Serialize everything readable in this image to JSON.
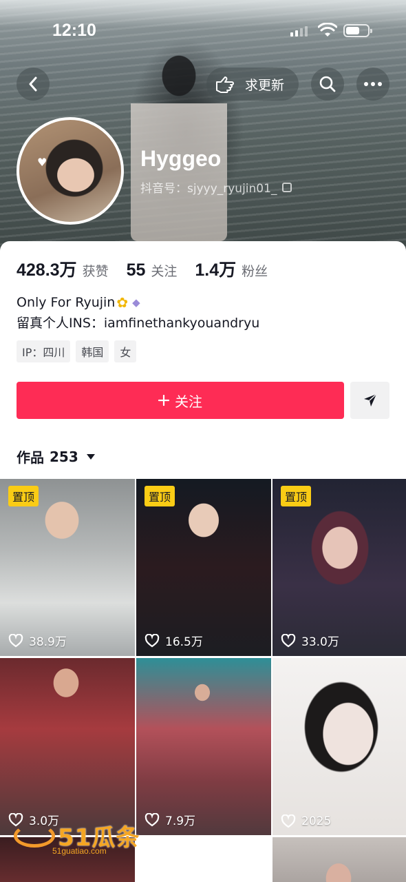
{
  "status_bar": {
    "time": "12:10"
  },
  "nav": {
    "update_label": "求更新"
  },
  "profile": {
    "name": "Hyggeo",
    "douyin_id": "抖音号：sjyyy_ryujin01_",
    "avatar_overlay": "♥"
  },
  "stats": [
    {
      "value": "428.3万",
      "label": "获赞"
    },
    {
      "value": "55",
      "label": "关注"
    },
    {
      "value": "1.4万",
      "label": "粉丝"
    }
  ],
  "bio": {
    "line1": "Only For Ryujin",
    "line2": "留真个人INS：iamfinethankyouandryu"
  },
  "tags": [
    "IP：四川",
    "韩国",
    "女"
  ],
  "follow_button": "关注",
  "works": {
    "label": "作品",
    "count": "253"
  },
  "grid": [
    {
      "pinned": true,
      "pin_label": "置顶",
      "likes": "38.9万"
    },
    {
      "pinned": true,
      "pin_label": "置顶",
      "likes": "16.5万"
    },
    {
      "pinned": true,
      "pin_label": "置顶",
      "likes": "33.0万"
    },
    {
      "pinned": false,
      "likes": "3.0万"
    },
    {
      "pinned": false,
      "likes": "7.9万"
    },
    {
      "pinned": false,
      "likes": "2025"
    }
  ],
  "watermark": {
    "brand": "51瓜条",
    "url": "51guatiao.com"
  },
  "colors": {
    "accent": "#fe2c55",
    "pin": "#facc15"
  }
}
